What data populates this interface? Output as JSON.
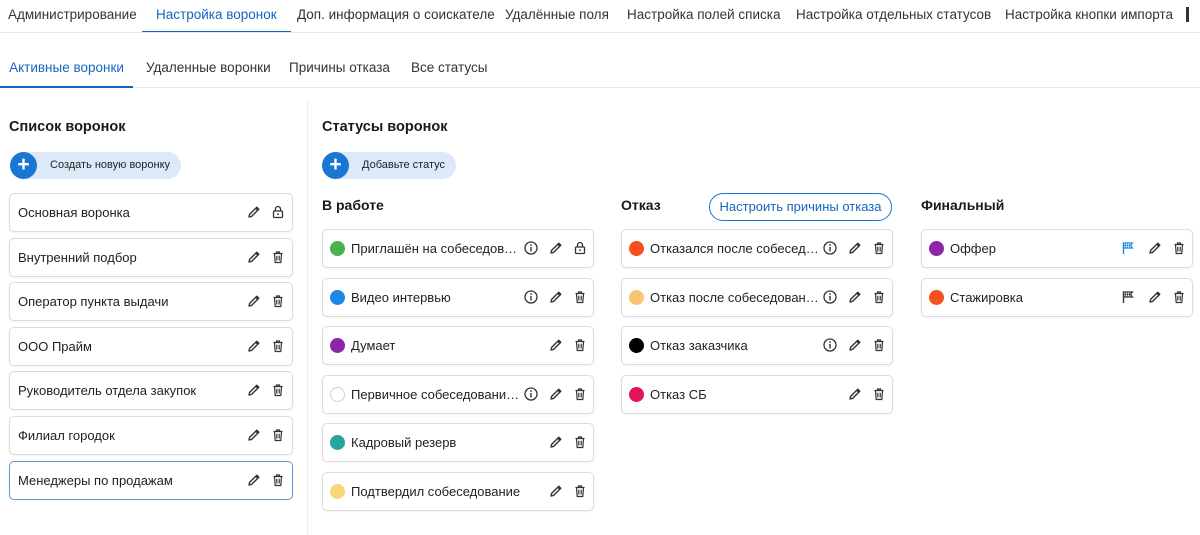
{
  "top_tabs": [
    {
      "label": "Администрирование"
    },
    {
      "label": "Настройка воронок"
    },
    {
      "label": "Доп. информация о соискателе"
    },
    {
      "label": "Удалённые поля"
    },
    {
      "label": "Настройка полей списка"
    },
    {
      "label": "Настройка отдельных статусов"
    },
    {
      "label": "Настройка кнопки импорта"
    }
  ],
  "top_tabs_active": "Настройка воронок",
  "sub_tabs": [
    {
      "label": "Активные воронки"
    },
    {
      "label": "Удаленные воронки"
    },
    {
      "label": "Причины отказа"
    },
    {
      "label": "Все статусы"
    }
  ],
  "sub_tabs_active": "Активные воронки",
  "funnels": {
    "title": "Список воронок",
    "add_label": "Создать новую воронку",
    "items": [
      {
        "name": "Основная воронка",
        "locked": true
      },
      {
        "name": "Внутренний подбор"
      },
      {
        "name": "Оператор пункта выдачи"
      },
      {
        "name": "ООО Прайм"
      },
      {
        "name": "Руководитель отдела закупок"
      },
      {
        "name": "Филиал городок"
      },
      {
        "name": "Менеджеры по продажам",
        "selected": true
      }
    ]
  },
  "statuses": {
    "title": "Статусы воронок",
    "add_label": "Добавьте статус",
    "reasons_button": "Настроить причины отказа",
    "columns": [
      {
        "title": "В работе",
        "items": [
          {
            "name": "Приглашён на собеседован...",
            "color": "#4caf50",
            "info": true,
            "locked": true
          },
          {
            "name": "Видео интервью",
            "color": "#1e88e5",
            "info": true
          },
          {
            "name": "Думает",
            "color": "#8e24aa"
          },
          {
            "name": "Первичное собеседование ...",
            "color": "#ffffff",
            "outline": true,
            "info": true
          },
          {
            "name": "Кадровый резерв",
            "color": "#26a69a"
          },
          {
            "name": "Подтвердил собеседование",
            "color": "#f7d77a"
          }
        ]
      },
      {
        "title": "Отказ",
        "items": [
          {
            "name": "Отказался после собеседо...",
            "color": "#f4511e",
            "info": true
          },
          {
            "name": "Отказ после собеседования",
            "color": "#f9c56e",
            "info": true
          },
          {
            "name": "Отказ заказчика",
            "color": "#000000",
            "info": true
          },
          {
            "name": "Отказ СБ",
            "color": "#e5135a"
          }
        ]
      },
      {
        "title": "Финальный",
        "items": [
          {
            "name": "Оффер",
            "color": "#8e24aa",
            "flag_color": "#1e88e5"
          },
          {
            "name": "Стажировка",
            "color": "#f4511e",
            "flag_color": "#333333"
          }
        ]
      }
    ]
  }
}
